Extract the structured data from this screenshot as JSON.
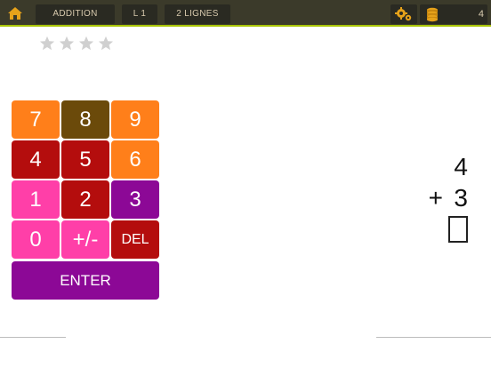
{
  "topbar": {
    "home_icon": "home-icon",
    "mode_label": "ADDITION",
    "level_label": "L 1",
    "lines_label": "2 LIGNES",
    "settings_icon": "gears-icon",
    "coins_icon": "coin-stack-icon",
    "coin_count": "4",
    "accent_color": "#a8c400"
  },
  "rating": {
    "stars_filled": 0,
    "stars_total": 4,
    "star_color": "#d0d0d0"
  },
  "keypad": {
    "keys": [
      {
        "label": "7",
        "color": "#ff7f1a"
      },
      {
        "label": "8",
        "color": "#6b4a0a"
      },
      {
        "label": "9",
        "color": "#ff7f1a"
      },
      {
        "label": "4",
        "color": "#b40d0d"
      },
      {
        "label": "5",
        "color": "#b40d0d"
      },
      {
        "label": "6",
        "color": "#ff7f1a"
      },
      {
        "label": "1",
        "color": "#ff3fa8"
      },
      {
        "label": "2",
        "color": "#b40d0d"
      },
      {
        "label": "3",
        "color": "#8c0896"
      },
      {
        "label": "0",
        "color": "#ff3fa8"
      },
      {
        "label": "+/-",
        "color": "#ff3fa8"
      },
      {
        "label": "DEL",
        "color": "#b40d0d"
      },
      {
        "label": "ENTER",
        "color": "#8c0896"
      }
    ]
  },
  "problem": {
    "top_number": "4",
    "operator": "+",
    "bottom_number": "3",
    "answer": ""
  }
}
